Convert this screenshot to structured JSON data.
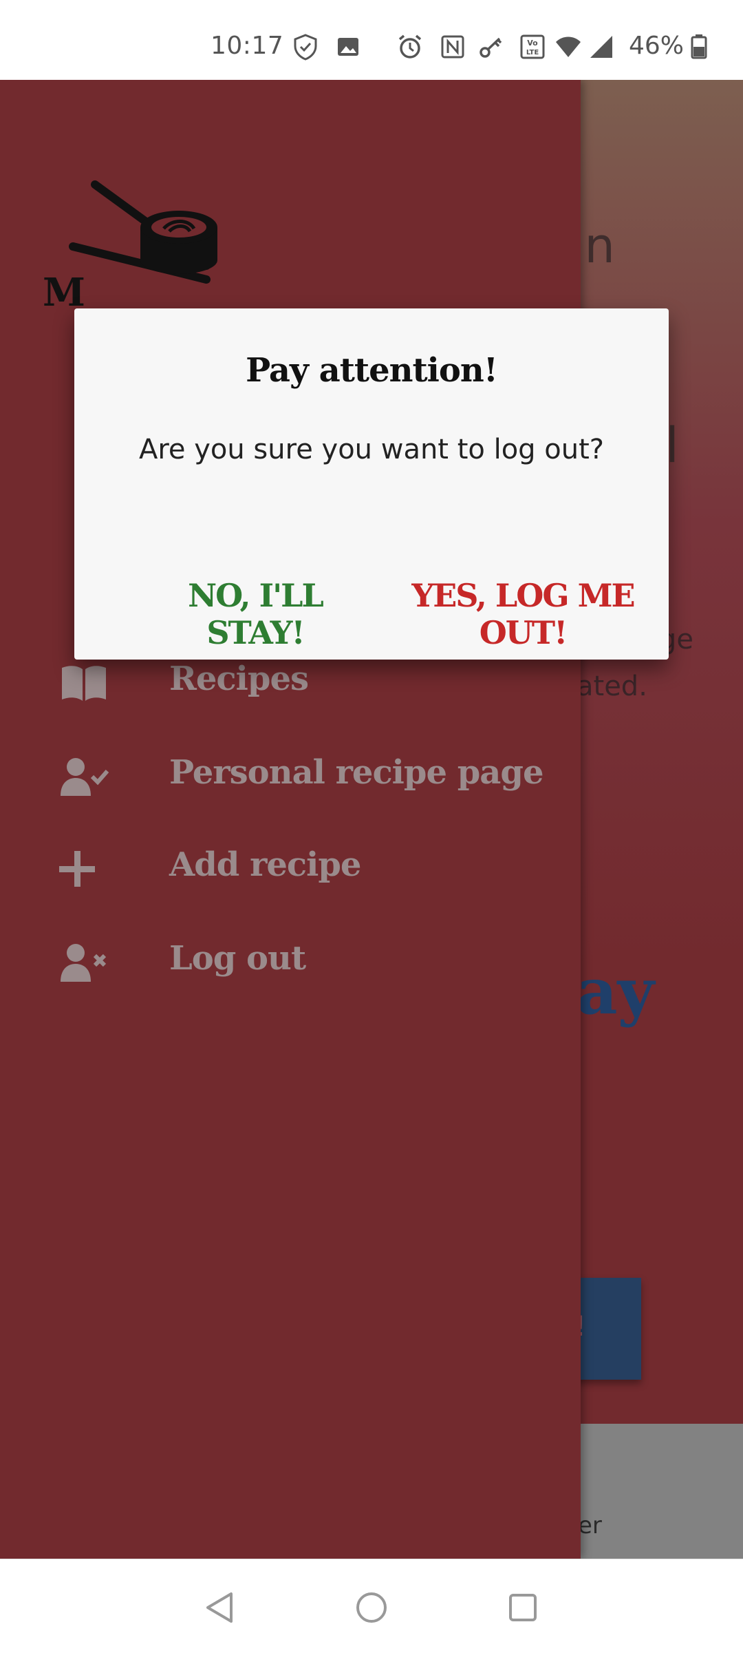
{
  "status_bar": {
    "time": "10:17",
    "battery": "46%",
    "icons": [
      "shield-check-icon",
      "image-icon",
      "alarm-icon",
      "nfc-icon",
      "key-icon",
      "volte-icon",
      "wifi-icon",
      "signal-icon",
      "battery-icon"
    ]
  },
  "background_page": {
    "title_fragment_1": "in",
    "title_fragment_2": "nal",
    "line_1": "his page",
    "line_2": "ated.",
    "accent_fragment": "ay",
    "button_fragment": "!",
    "footer_fragment": "er"
  },
  "drawer": {
    "logo_text": "M",
    "items": [
      {
        "label": "Recipes",
        "icon": "book-icon"
      },
      {
        "label": "Personal recipe page",
        "icon": "user-check-icon"
      },
      {
        "label": "Add recipe",
        "icon": "plus-icon"
      },
      {
        "label": "Log out",
        "icon": "user-times-icon"
      }
    ]
  },
  "dialog": {
    "title": "Pay attention!",
    "message": "Are you sure you want to log out?",
    "cancel_label": "NO, I'LL STAY!",
    "confirm_label": "YES, LOG ME OUT!"
  },
  "colors": {
    "drawer_bg": "#722a2e",
    "cancel": "#2e7d32",
    "confirm": "#c62828",
    "dialog_bg": "#f7f7f7"
  }
}
